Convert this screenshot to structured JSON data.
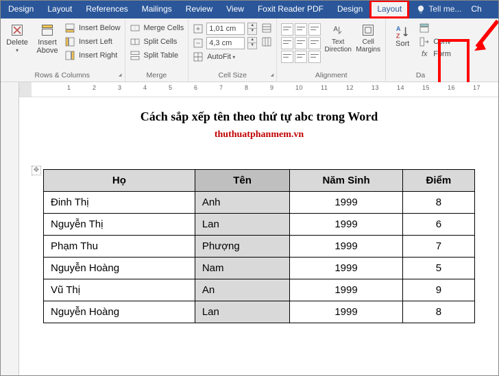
{
  "tabs": [
    "Design",
    "Layout",
    "References",
    "Mailings",
    "Review",
    "View",
    "Foxit Reader PDF",
    "Design",
    "Layout"
  ],
  "active_tab_index": 8,
  "tell_me": "Tell me...",
  "extra_right": "Ch",
  "ribbon": {
    "rows_columns": {
      "label": "Rows & Columns",
      "delete": "Delete",
      "insert_above": "Insert Above",
      "items": [
        "Insert Below",
        "Insert Left",
        "Insert Right"
      ]
    },
    "merge": {
      "label": "Merge",
      "items": [
        "Merge Cells",
        "Split Cells",
        "Split Table"
      ]
    },
    "cell_size": {
      "label": "Cell Size",
      "height": "1,01 cm",
      "width": "4,3 cm",
      "autofit": "AutoFit"
    },
    "alignment": {
      "label": "Alignment",
      "text_direction": "Text Direction",
      "cell_margins": "Cell Margins"
    },
    "data": {
      "label": "Da",
      "sort": "Sort",
      "convert": "Conv",
      "formula": "Form"
    }
  },
  "ruler_numbers": [
    "1",
    "",
    "1",
    "2",
    "3",
    "4",
    "5",
    "6",
    "7",
    "8",
    "9",
    "10",
    "11",
    "12",
    "13",
    "14",
    "15",
    "16",
    "17",
    "1"
  ],
  "document": {
    "title": "Cách sắp xếp tên theo thứ tự abc trong Word",
    "subtitle": "thuthuatphanmem.vn",
    "headers": [
      "Họ",
      "Tên",
      "Năm Sinh",
      "Điểm"
    ],
    "rows": [
      {
        "ho": "Đinh Thị",
        "ten": "Anh",
        "nam": "1999",
        "diem": "8"
      },
      {
        "ho": "Nguyễn Thị",
        "ten": "Lan",
        "nam": "1999",
        "diem": "6"
      },
      {
        "ho": "Phạm Thu",
        "ten": "Phượng",
        "nam": "1999",
        "diem": "7"
      },
      {
        "ho": "Nguyễn Hoàng",
        "ten": "Nam",
        "nam": "1999",
        "diem": "5"
      },
      {
        "ho": "Vũ Thị",
        "ten": "An",
        "nam": "1999",
        "diem": "9"
      },
      {
        "ho": "Nguyễn Hoàng",
        "ten": "Lan",
        "nam": "1999",
        "diem": "8"
      }
    ]
  }
}
